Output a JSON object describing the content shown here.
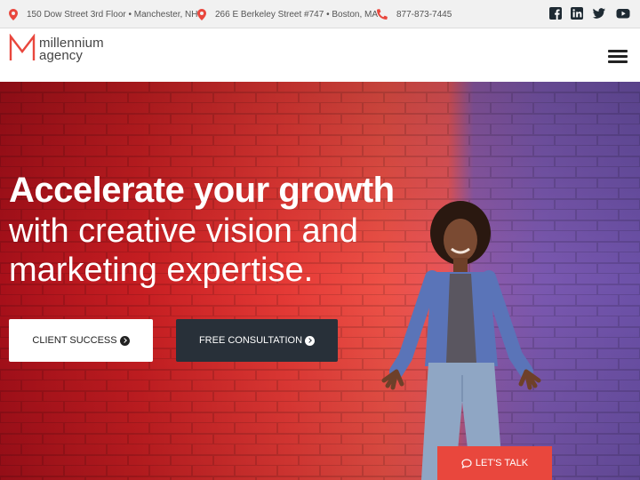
{
  "topbar": {
    "address_1": "150 Dow Street 3rd Floor • Manchester, NH",
    "address_2": "266 E Berkeley Street #747 • Boston, MA",
    "phone": "877-873-7445",
    "location_icon": "map-pin-icon",
    "phone_icon": "phone-icon",
    "social": [
      "facebook-icon",
      "linkedin-icon",
      "twitter-icon",
      "youtube-icon"
    ]
  },
  "header": {
    "logo_line_1": "millennium",
    "logo_line_2": "agency",
    "menu_icon": "hamburger-menu-icon"
  },
  "hero": {
    "headline": "Accelerate your growth",
    "subline_1": "with creative vision and",
    "subline_2": "marketing expertise.",
    "primary_button": "CLIENT SUCCESS",
    "secondary_button": "FREE CONSULTATION",
    "chat_button": "LET'S TALK"
  },
  "colors": {
    "brand_red": "#e9473d",
    "dark_button": "#283039",
    "topbar_bg": "#f1f1f1"
  }
}
